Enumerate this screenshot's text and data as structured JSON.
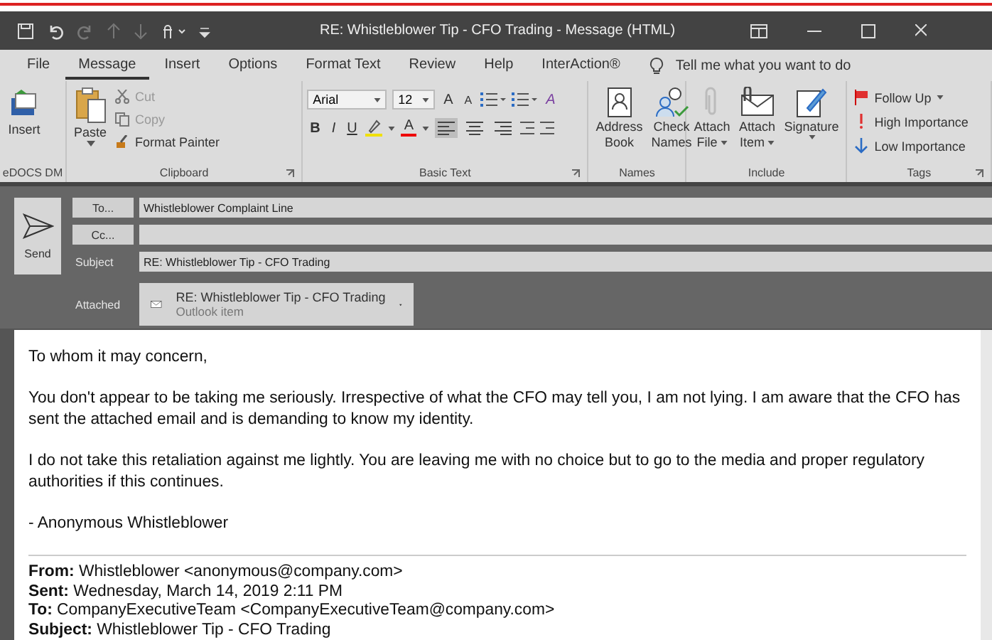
{
  "window": {
    "title": "RE: Whistleblower Tip - CFO Trading  -  Message (HTML)"
  },
  "tabs": [
    {
      "label": "File",
      "selected": false
    },
    {
      "label": "Message",
      "selected": true
    },
    {
      "label": "Insert",
      "selected": false
    },
    {
      "label": "Options",
      "selected": false
    },
    {
      "label": "Format Text",
      "selected": false
    },
    {
      "label": "Review",
      "selected": false
    },
    {
      "label": "Help",
      "selected": false
    },
    {
      "label": "InterAction®",
      "selected": false
    }
  ],
  "tell_me": {
    "placeholder": "Tell me what you want to do"
  },
  "ribbon": {
    "edocs": {
      "name": "eDOCS DM",
      "button": "Insert"
    },
    "clipboard": {
      "name": "Clipboard",
      "paste": "Paste",
      "small": [
        {
          "label": "Cut",
          "kind": "cut",
          "disabled": true
        },
        {
          "label": "Copy",
          "kind": "copy",
          "disabled": true
        },
        {
          "label": "Format Painter",
          "kind": "painter",
          "disabled": false
        }
      ]
    },
    "basic_text": {
      "name": "Basic Text",
      "font": "Arial",
      "size": "12",
      "grow": "A",
      "shrink": "A",
      "clear": "A",
      "format": [
        {
          "label": "B",
          "kind": "bold"
        },
        {
          "label": "I",
          "kind": "italic"
        },
        {
          "label": "U",
          "kind": "underline"
        }
      ],
      "font_color": "A",
      "align": [
        {
          "kind": "left",
          "selected": true
        },
        {
          "kind": "center",
          "selected": false
        },
        {
          "kind": "right",
          "selected": false
        }
      ]
    },
    "names": {
      "name": "Names",
      "buttons": [
        {
          "lines": [
            "Address",
            "Book"
          ],
          "kind": "book"
        },
        {
          "lines": [
            "Check",
            "Names"
          ],
          "kind": "people"
        }
      ]
    },
    "include": {
      "name": "Include",
      "buttons": [
        {
          "lines": [
            "Attach",
            "File"
          ],
          "kind": "clip",
          "dropdown": true
        },
        {
          "lines": [
            "Attach",
            "Item"
          ],
          "kind": "envelope",
          "dropdown": true
        },
        {
          "lines": [
            "Signature"
          ],
          "kind": "signature",
          "dropdown": true
        }
      ]
    },
    "tags": {
      "name": "Tags",
      "items": [
        {
          "label": "Follow Up",
          "kind": "flag",
          "dropdown": true
        },
        {
          "label": "High Importance",
          "kind": "high",
          "dropdown": false
        },
        {
          "label": "Low Importance",
          "kind": "low",
          "dropdown": false
        }
      ]
    }
  },
  "compose": {
    "send": "Send",
    "to_button": "To...",
    "to_value": "Whistleblower Complaint Line",
    "cc_button": "Cc...",
    "subject_label": "Subject",
    "subject_value": "RE: Whistleblower Tip - CFO Trading",
    "attached_label": "Attached",
    "attachment": {
      "name": "RE: Whistleblower Tip - CFO Trading",
      "type": "Outlook item"
    }
  },
  "body": {
    "paragraphs": [
      "To whom it may concern,",
      "You don't appear to be taking me seriously. Irrespective of what the CFO may tell you, I am not lying. I am aware that the CFO has sent the attached email and is demanding to know my identity.",
      "I do not take this retaliation against me lightly. You are leaving me with no choice but to go to the media and proper regulatory authorities if this continues.",
      "- Anonymous Whistleblower"
    ],
    "quoted_header": [
      "**From:** Whistleblower <anonymous@company.com>",
      "**Sent:** Wednesday, March 14, 2019 2:11 PM",
      "**To:** CompanyExecutiveTeam <CompanyExecutiveTeam@company.com>",
      "**Subject:** Whistleblower Tip - CFO Trading"
    ]
  }
}
